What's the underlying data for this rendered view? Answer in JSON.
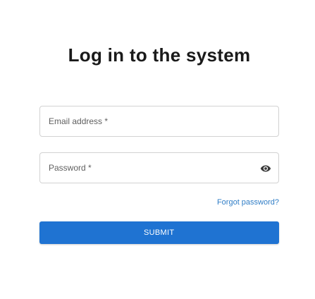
{
  "page": {
    "title": "Log in to the system"
  },
  "form": {
    "email": {
      "placeholder": "Email address *",
      "value": ""
    },
    "password": {
      "placeholder": "Password *",
      "value": "",
      "toggle_icon": "eye-icon"
    },
    "forgot_label": "Forgot password?",
    "submit_label": "SUBMIT"
  },
  "colors": {
    "accent": "#1f73d2",
    "link": "#2f7dc6",
    "border": "#d2d2d2",
    "title": "#1a1a1a"
  }
}
